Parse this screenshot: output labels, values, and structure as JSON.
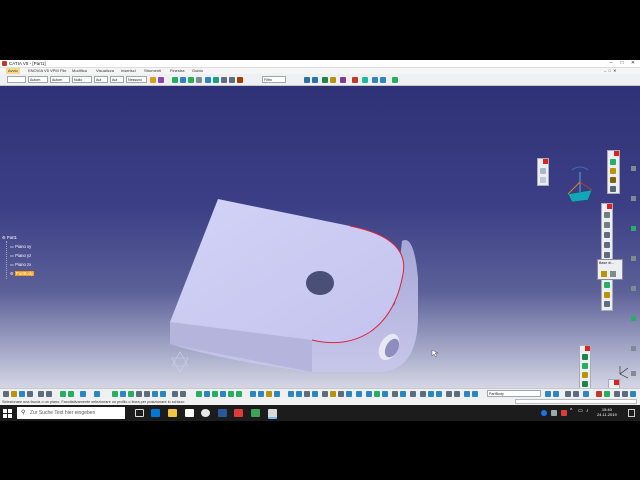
{
  "window": {
    "title": "CATIA V5 - [Part1]"
  },
  "menu": [
    {
      "label": "Avvio",
      "active": true
    },
    {
      "label": "ENOVIA V5 VPM"
    },
    {
      "label": "File"
    },
    {
      "label": "Modifica"
    },
    {
      "label": "Visualizza"
    },
    {
      "label": "Inserisci"
    },
    {
      "label": "Strumenti"
    },
    {
      "label": "Finestra"
    },
    {
      "label": "Guida"
    }
  ],
  "toolbar": {
    "combos": [
      "Autom",
      "Autom",
      "Nullo",
      "Aut",
      "Aut",
      "Nessuno"
    ],
    "filter": "Filtro"
  },
  "tree": {
    "root": "Part1",
    "items": [
      "Piano xy",
      "Piano yz",
      "Piano zx"
    ],
    "selected": "PartBody"
  },
  "floating_window": {
    "title": "Base di..."
  },
  "status": {
    "message": "Selezionare una faccia o un piano. Facoltativamente selezionare un profilo o linea per posizionare lo schizzo",
    "command_value": "PartBody"
  },
  "taskbar": {
    "search_placeholder": "Zur Suche Text hier eingeben",
    "time": "15:40",
    "date": "24.11.2019"
  },
  "colors": {
    "selection_accent": "#f39c12",
    "part_edge": "#e0223a",
    "part_face": "#c9c9ef"
  }
}
